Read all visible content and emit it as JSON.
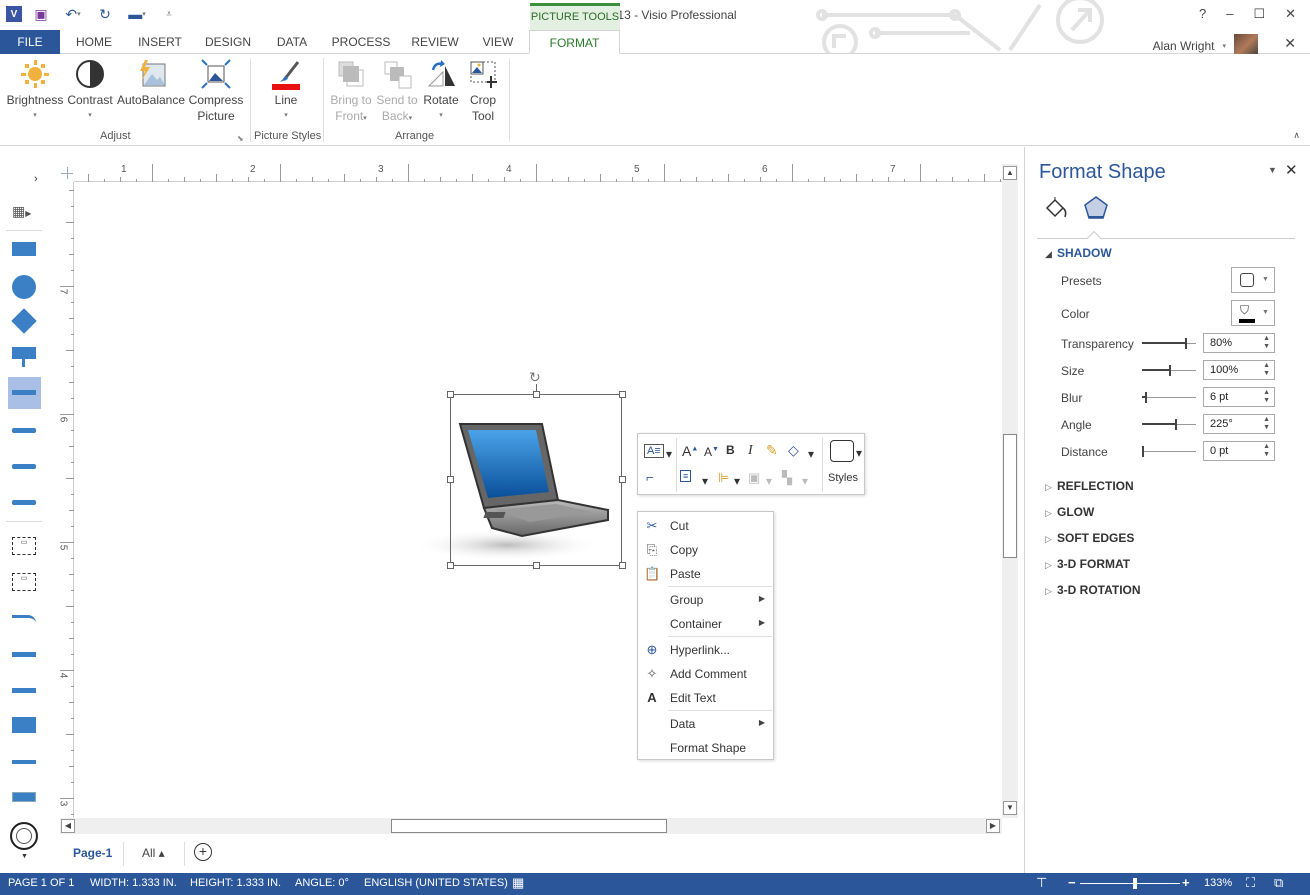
{
  "window": {
    "title": "Drawing13 - Visio Professional",
    "context_tab_group": "PICTURE TOOLS",
    "controls": {
      "help": "?",
      "minimize": "–",
      "maximize": "☐",
      "close": "✕"
    }
  },
  "quick_access": [
    "visio-logo",
    "save-icon",
    "undo-icon",
    "redo-icon",
    "presentation-icon",
    "customize-icon"
  ],
  "tabs": [
    {
      "label": "FILE"
    },
    {
      "label": "HOME"
    },
    {
      "label": "INSERT"
    },
    {
      "label": "DESIGN"
    },
    {
      "label": "DATA"
    },
    {
      "label": "PROCESS"
    },
    {
      "label": "REVIEW"
    },
    {
      "label": "VIEW"
    },
    {
      "label": "FORMAT",
      "active": true
    }
  ],
  "user": {
    "name": "Alan Wright"
  },
  "ribbon": {
    "groups": [
      {
        "label": "Adjust",
        "buttons": [
          {
            "label": "Brightness",
            "has_dropdown": true
          },
          {
            "label": "Contrast",
            "has_dropdown": true
          },
          {
            "label": "AutoBalance"
          },
          {
            "label": "Compress",
            "label2": "Picture"
          }
        ]
      },
      {
        "label": "Picture Styles",
        "buttons": [
          {
            "label": "Line",
            "has_dropdown": true
          }
        ]
      },
      {
        "label": "Arrange",
        "buttons": [
          {
            "label": "Bring to",
            "label2": "Front",
            "disabled": true
          },
          {
            "label": "Send to",
            "label2": "Back",
            "disabled": true
          },
          {
            "label": "Rotate",
            "has_dropdown": true
          },
          {
            "label": "Crop",
            "label2": "Tool"
          }
        ]
      }
    ],
    "line_color": "#e81010"
  },
  "rulers": {
    "horizontal": [
      "1",
      "2",
      "3",
      "4",
      "5",
      "6",
      "7"
    ],
    "vertical": [
      "7",
      "6",
      "5",
      "4",
      "3"
    ]
  },
  "floating_toolbar": {
    "styles_label": "Styles",
    "buttons": [
      "text-block-icon",
      "increase-font-icon",
      "decrease-font-icon",
      "bold-icon",
      "italic-icon",
      "format-painter-icon",
      "shape-icon",
      "connector-icon",
      "align-icon",
      "position-icon",
      "bring-forward-icon",
      "send-backward-icon"
    ]
  },
  "context_menu": {
    "items": [
      {
        "label": "Cut",
        "icon": "scissors"
      },
      {
        "label": "Copy",
        "icon": "copy"
      },
      {
        "label": "Paste",
        "icon": "paste"
      },
      {
        "label": "Group",
        "submenu": true
      },
      {
        "label": "Container",
        "submenu": true
      },
      {
        "label": "Hyperlink...",
        "icon": "hyperlink"
      },
      {
        "label": "Add Comment",
        "icon": "comment"
      },
      {
        "label": "Edit Text",
        "icon": "A"
      },
      {
        "label": "Data",
        "submenu": true
      },
      {
        "label": "Format Shape"
      }
    ]
  },
  "page_tabs": {
    "current": "Page-1",
    "all_label": "All ▴"
  },
  "status": {
    "page": "PAGE 1 OF 1",
    "width": "WIDTH: 1.333 IN.",
    "height": "HEIGHT: 1.333 IN.",
    "angle": "ANGLE: 0°",
    "language": "ENGLISH (UNITED STATES)",
    "zoom": "133%",
    "zoom_fraction": 0.55
  },
  "format_panel": {
    "title": "Format Shape",
    "section_open": "SHADOW",
    "presets_label": "Presets",
    "color_label": "Color",
    "properties": [
      {
        "label": "Transparency",
        "value": "80%",
        "slider": 0.8
      },
      {
        "label": "Size",
        "value": "100%",
        "slider": 0.5
      },
      {
        "label": "Blur",
        "value": "6 pt",
        "slider": 0.05
      },
      {
        "label": "Angle",
        "value": "225°",
        "slider": 0.62
      },
      {
        "label": "Distance",
        "value": "0 pt",
        "slider": 0.0
      }
    ],
    "collapsed_sections": [
      "REFLECTION",
      "GLOW",
      "SOFT EDGES",
      "3-D FORMAT",
      "3-D ROTATION"
    ]
  },
  "colors": {
    "accent": "#2b579a",
    "format_tab": "#2a7a2a",
    "panel_title": "#2b579a",
    "shape_blue": "#3b7fc4"
  }
}
